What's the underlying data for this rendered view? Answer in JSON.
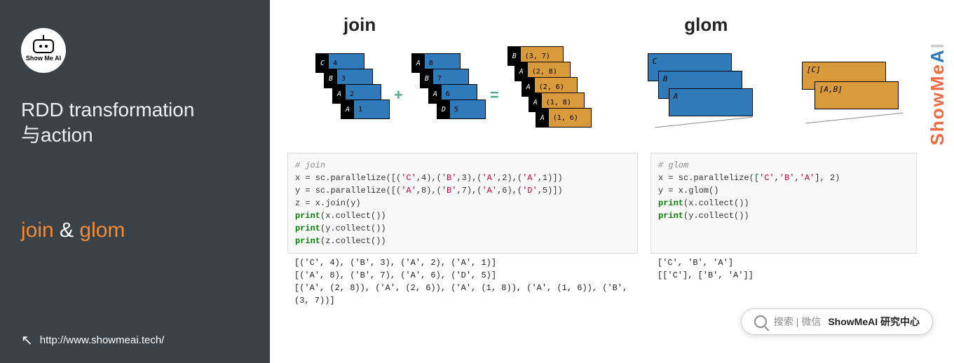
{
  "sidebar": {
    "logo_text": "Show Me AI",
    "title_line1": "RDD transformation",
    "title_line2": "与action",
    "subtitle_join": "join",
    "subtitle_amp": " & ",
    "subtitle_glom": "glom",
    "url": "http://www.showmeai.tech/"
  },
  "headings": {
    "join": "join",
    "glom": "glom"
  },
  "brand": {
    "a": "ShowMe",
    "b": "A",
    "c": "I"
  },
  "diagram": {
    "join_left": [
      {
        "k": "C",
        "v": "4"
      },
      {
        "k": "B",
        "v": "3"
      },
      {
        "k": "A",
        "v": "2"
      },
      {
        "k": "A",
        "v": "1"
      }
    ],
    "join_right": [
      {
        "k": "A",
        "v": "8"
      },
      {
        "k": "B",
        "v": "7"
      },
      {
        "k": "A",
        "v": "6"
      },
      {
        "k": "D",
        "v": "5"
      }
    ],
    "join_result": [
      {
        "k": "B",
        "v": "(3, 7)"
      },
      {
        "k": "A",
        "v": "(2, 8)"
      },
      {
        "k": "A",
        "v": "(2, 6)"
      },
      {
        "k": "A",
        "v": "(1, 8)"
      },
      {
        "k": "A",
        "v": "(1, 6)"
      }
    ],
    "plus": "+",
    "eq": "=",
    "glom_left": [
      "C",
      "B",
      "A"
    ],
    "glom_right": [
      "[C]",
      "[A,B]"
    ]
  },
  "code_join": {
    "comment": "# join",
    "l1a": "x = sc.parallelize([(",
    "l1b": "'C'",
    "l1c": ",4),(",
    "l1d": "'B'",
    "l1e": ",3),(",
    "l1f": "'A'",
    "l1g": ",2),(",
    "l1h": "'A'",
    "l1i": ",1)])",
    "l2a": "y = sc.parallelize([(",
    "l2b": "'A'",
    "l2c": ",8),(",
    "l2d": "'B'",
    "l2e": ",7),(",
    "l2f": "'A'",
    "l2g": ",6),(",
    "l2h": "'D'",
    "l2i": ",5)])",
    "l3": "z = x.join(y)",
    "p": "print",
    "px": "(x.collect())",
    "py": "(y.collect())",
    "pz": "(z.collect())"
  },
  "code_glom": {
    "comment": "# glom",
    "l1a": "x = sc.parallelize([",
    "l1b": "'C'",
    "l1c": ",",
    "l1d": "'B'",
    "l1e": ",",
    "l1f": "'A'",
    "l1g": "], 2)",
    "l2": "y = x.glom()",
    "p": "print",
    "px": "(x.collect())",
    "py": "(y.collect())"
  },
  "output": {
    "j1": "[('C', 4), ('B', 3), ('A', 2), ('A', 1)]",
    "j2": "[('A', 8), ('B', 7), ('A', 6), ('D', 5)]",
    "j3": "[('A', (2, 8)), ('A', (2, 6)), ('A', (1, 8)), ('A', (1, 6)), ('B', (3, 7))]",
    "g1": "['C', 'B', 'A']",
    "g2": "[['C'], ['B', 'A']]"
  },
  "search": {
    "label1": "搜索",
    "sep": " | ",
    "label2": "微信",
    "brand": "ShowMeAI 研究中心"
  }
}
